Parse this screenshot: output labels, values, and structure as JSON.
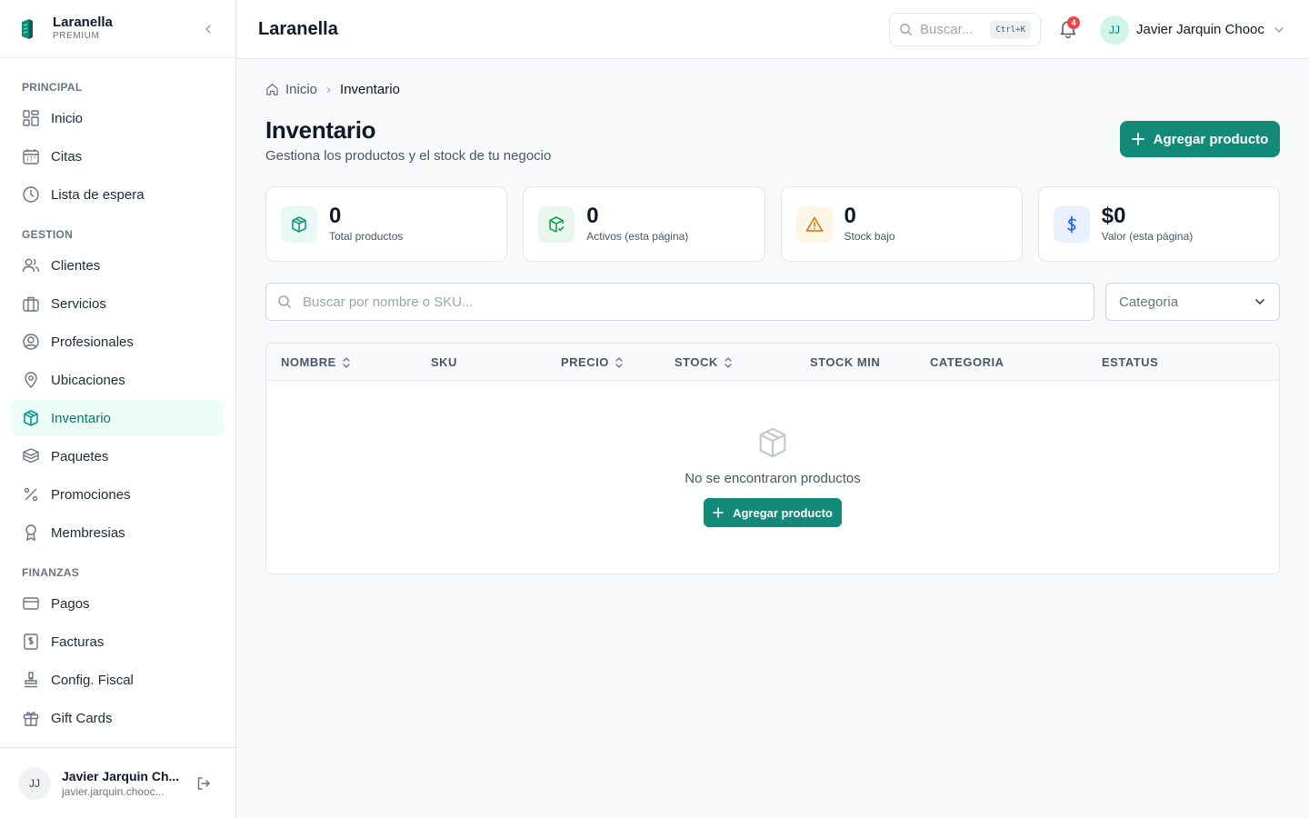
{
  "brand": {
    "name": "Laranella",
    "tier": "PREMIUM"
  },
  "sidebar": {
    "sections": [
      {
        "title": "PRINCIPAL",
        "items": [
          {
            "label": "Inicio",
            "icon": "dashboard-icon"
          },
          {
            "label": "Citas",
            "icon": "calendar-icon"
          },
          {
            "label": "Lista de espera",
            "icon": "clock-icon"
          }
        ]
      },
      {
        "title": "GESTION",
        "items": [
          {
            "label": "Clientes",
            "icon": "users-icon"
          },
          {
            "label": "Servicios",
            "icon": "briefcase-icon"
          },
          {
            "label": "Profesionales",
            "icon": "user-circle-icon"
          },
          {
            "label": "Ubicaciones",
            "icon": "map-pin-icon"
          },
          {
            "label": "Inventario",
            "icon": "box-icon",
            "active": true
          },
          {
            "label": "Paquetes",
            "icon": "package-icon"
          },
          {
            "label": "Promociones",
            "icon": "percent-icon"
          },
          {
            "label": "Membresias",
            "icon": "award-icon"
          }
        ]
      },
      {
        "title": "FINANZAS",
        "items": [
          {
            "label": "Pagos",
            "icon": "credit-card-icon"
          },
          {
            "label": "Facturas",
            "icon": "invoice-icon"
          },
          {
            "label": "Config. Fiscal",
            "icon": "stamp-icon"
          },
          {
            "label": "Gift Cards",
            "icon": "gift-icon"
          }
        ]
      }
    ],
    "footer": {
      "initials": "JJ",
      "name": "Javier Jarquin Ch...",
      "email": "javier.jarquin.chooc..."
    }
  },
  "header": {
    "title": "Laranella",
    "search_placeholder": "Buscar...",
    "shortcut": "Ctrl+K",
    "notifications_count": "4",
    "user_initials": "JJ",
    "user_name": "Javier Jarquin Chooc"
  },
  "breadcrumb": {
    "home": "Inicio",
    "current": "Inventario"
  },
  "page": {
    "title": "Inventario",
    "subtitle": "Gestiona los productos y el stock de tu negocio",
    "add_button": "Agregar producto"
  },
  "stats": [
    {
      "value": "0",
      "label": "Total productos",
      "icon": "box-icon",
      "color": "#0f9a86",
      "bg": "#e8f8f3"
    },
    {
      "value": "0",
      "label": "Activos (esta página)",
      "icon": "box-check-icon",
      "color": "#16a34a",
      "bg": "#e9f7ee"
    },
    {
      "value": "0",
      "label": "Stock bajo",
      "icon": "warning-icon",
      "color": "#d97706",
      "bg": "#fef6e4"
    },
    {
      "value": "$0",
      "label": "Valor (esta página)",
      "icon": "dollar-icon",
      "color": "#2563eb",
      "bg": "#eaf0fd"
    }
  ],
  "filters": {
    "search_placeholder": "Buscar por nombre o SKU...",
    "category_placeholder": "Categoria"
  },
  "table": {
    "columns": [
      {
        "label": "NOMBRE",
        "sortable": true
      },
      {
        "label": "SKU",
        "sortable": false
      },
      {
        "label": "PRECIO",
        "sortable": true
      },
      {
        "label": "STOCK",
        "sortable": true
      },
      {
        "label": "STOCK MIN",
        "sortable": false
      },
      {
        "label": "CATEGORIA",
        "sortable": false
      },
      {
        "label": "ESTATUS",
        "sortable": false
      }
    ],
    "empty_text": "No se encontraron productos",
    "empty_button": "Agregar producto"
  },
  "colors": {
    "accent": "#138a77",
    "active_bg": "#ecfdf7",
    "badge": "#ef4444"
  }
}
